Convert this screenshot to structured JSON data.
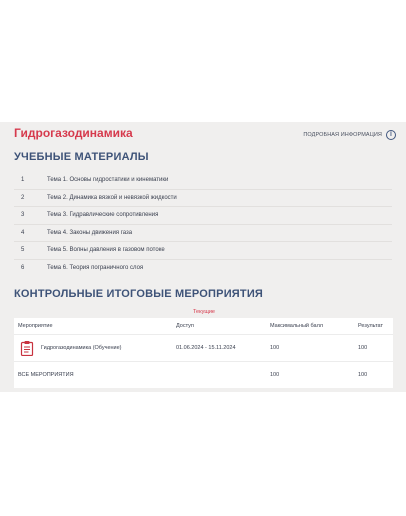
{
  "course": {
    "title": "Гидрогазодинамика",
    "more_info_label": "ПОДРОБНАЯ ИНФОРМАЦИЯ",
    "info_icon": "i"
  },
  "materials": {
    "title": "УЧЕБНЫЕ МАТЕРИАЛЫ",
    "topics": [
      {
        "num": "1",
        "label": "Тема 1. Основы гидростатики и кинематики"
      },
      {
        "num": "2",
        "label": "Тема 2. Динамика вязкой и невязкой жидкости"
      },
      {
        "num": "3",
        "label": "Тема 3. Гидравлические сопротивления"
      },
      {
        "num": "4",
        "label": "Тема 4. Законы движения газа"
      },
      {
        "num": "5",
        "label": "Тема 5. Волны давления в газовом потоке"
      },
      {
        "num": "6",
        "label": "Тема 6. Теория пограничного слоя"
      }
    ]
  },
  "activities": {
    "title": "КОНТРОЛЬНЫЕ ИТОГОВЫЕ МЕРОПРИЯТИЯ",
    "tab_label": "Текущие",
    "columns": [
      "Мероприятие",
      "Доступ",
      "Максимальный балл",
      "Результат"
    ],
    "rows": [
      {
        "name": "Гидрогазодинамика (Обучение)",
        "access": "01.06.2024 - 15.11.2024",
        "max": "100",
        "result": "100",
        "icon": "clipboard-icon"
      }
    ],
    "total": {
      "label": "ВСЕ МЕРОПРИЯТИЯ",
      "max": "100",
      "result": "100"
    }
  },
  "colors": {
    "accent": "#d63a4d",
    "heading": "#3e5378",
    "panel_bg": "#f0efee"
  }
}
